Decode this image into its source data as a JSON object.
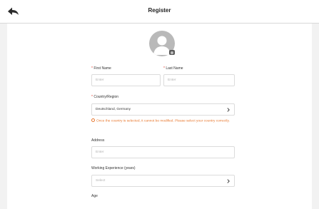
{
  "header": {
    "title": "Register"
  },
  "form": {
    "first_name": {
      "label": "First Name",
      "placeholder": "Enter"
    },
    "last_name": {
      "label": "Last Name",
      "placeholder": "Enter"
    },
    "country": {
      "label": "Country/Region",
      "value": "Deutschland, Germany",
      "warning": "Once the country is selected, it cannot be modified. Please select your country correctly."
    },
    "address": {
      "label": "Address",
      "placeholder": "Enter"
    },
    "working_experience": {
      "label": "Working Experience (years)",
      "placeholder": "Select"
    },
    "age": {
      "label": "Age"
    }
  },
  "icons": {
    "back": "back-arrow-icon",
    "avatar": "user-avatar-icon",
    "camera": "camera-icon",
    "chevron": "chevron-right-icon",
    "warning": "info-circle-icon"
  },
  "colors": {
    "required": "#e03b2f",
    "warning": "#e8782f",
    "border": "#dcdcdc"
  }
}
